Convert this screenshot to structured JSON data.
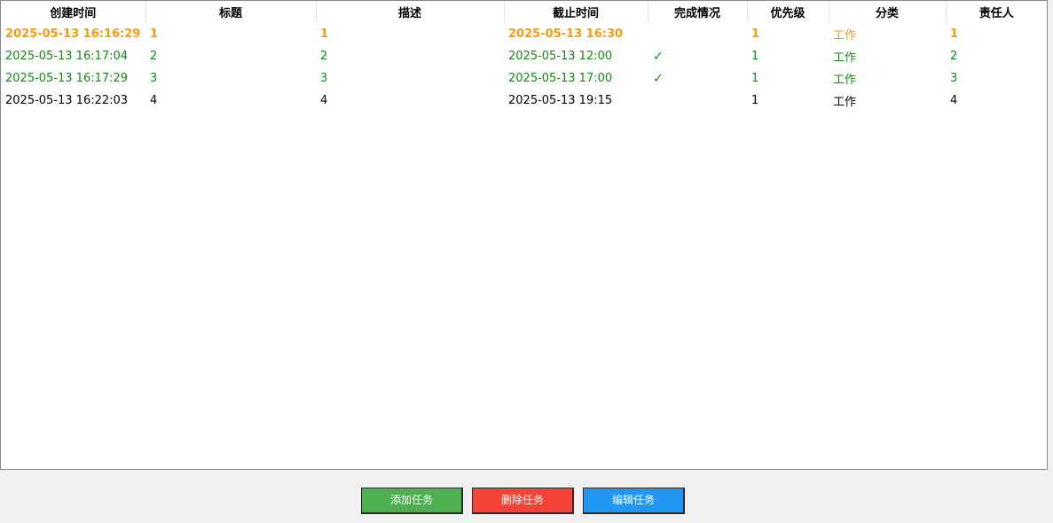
{
  "table": {
    "columns": [
      "创建时间",
      "标题",
      "描述",
      "截止时间",
      "完成情况",
      "优先级",
      "分类",
      "责任人"
    ],
    "rows": [
      {
        "style": "orange",
        "created": "2025-05-13 16:16:29",
        "title": "1",
        "description": "1",
        "deadline": "2025-05-13 16:30",
        "done": "",
        "priority": "1",
        "category": "工作",
        "owner": "1"
      },
      {
        "style": "green",
        "created": "2025-05-13 16:17:04",
        "title": "2",
        "description": "2",
        "deadline": "2025-05-13 12:00",
        "done": "✓",
        "priority": "1",
        "category": "工作",
        "owner": "2"
      },
      {
        "style": "green",
        "created": "2025-05-13 16:17:29",
        "title": "3",
        "description": "3",
        "deadline": "2025-05-13 17:00",
        "done": "✓",
        "priority": "1",
        "category": "工作",
        "owner": "3"
      },
      {
        "style": "black",
        "created": "2025-05-13 16:22:03",
        "title": "4",
        "description": "4",
        "deadline": "2025-05-13 19:15",
        "done": "",
        "priority": "1",
        "category": "工作",
        "owner": "4"
      }
    ]
  },
  "buttons": {
    "add_label": "添加任务",
    "delete_label": "删除任务",
    "edit_label": "编辑任务"
  },
  "colors": {
    "overdue": "#f39c12",
    "completed": "#138a13",
    "normal": "#000000",
    "add_button": "#4caf50",
    "delete_button": "#f44336",
    "edit_button": "#2196f3"
  }
}
